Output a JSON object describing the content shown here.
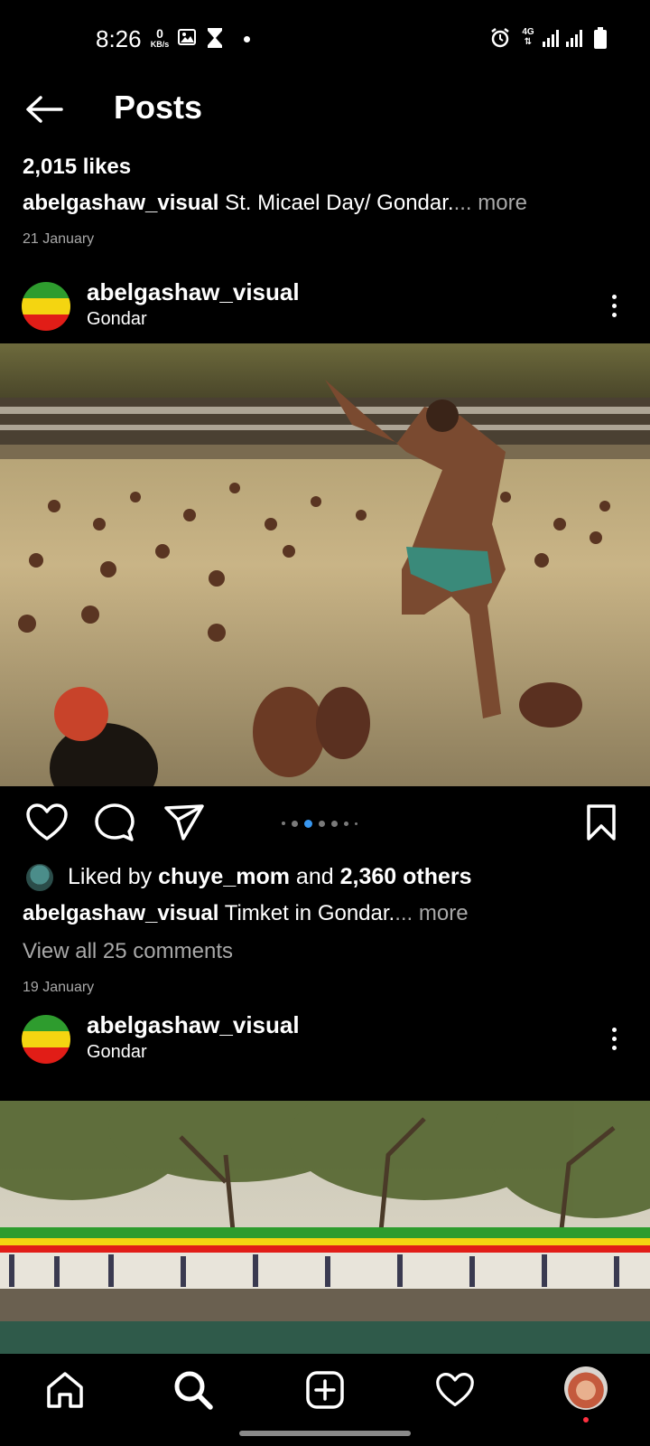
{
  "status_bar": {
    "time": "8:26",
    "net_speed_value": "0",
    "net_speed_unit": "KB/s",
    "network": "4G",
    "icons": [
      "image-icon",
      "hourglass-icon",
      "alarm-icon",
      "signal-icon",
      "battery-icon"
    ]
  },
  "header": {
    "title": "Posts",
    "back_icon": "arrow-left-icon"
  },
  "previous_post": {
    "likes": "2,015 likes",
    "username": "abelgashaw_visual",
    "caption": "St. Micael Day/ Gondar.",
    "more": "... more",
    "date": "21 January"
  },
  "post1": {
    "username": "abelgashaw_visual",
    "location": "Gondar",
    "liked_by_prefix": "Liked by",
    "liked_by_user": "chuye_mom",
    "liked_by_and": "and",
    "liked_by_others": "2,360 others",
    "caption_user": "abelgashaw_visual",
    "caption": "Timket in Gondar.",
    "more": "... more",
    "view_comments": "View all 25 comments",
    "date": "19 January",
    "carousel_active_index": 2,
    "carousel_count": 7
  },
  "post2": {
    "username": "abelgashaw_visual",
    "location": "Gondar"
  },
  "colors": {
    "background": "#000000",
    "muted_text": "#a8a8a8",
    "carousel_active": "#3897f0",
    "flag_green": "#2e9c2e",
    "flag_yellow": "#f4d511",
    "flag_red": "#e11d17",
    "notification_dot": "#ff3040"
  },
  "bottom_nav": {
    "items": [
      "home-icon",
      "search-icon",
      "add-post-icon",
      "activity-heart-icon",
      "profile-avatar"
    ]
  }
}
